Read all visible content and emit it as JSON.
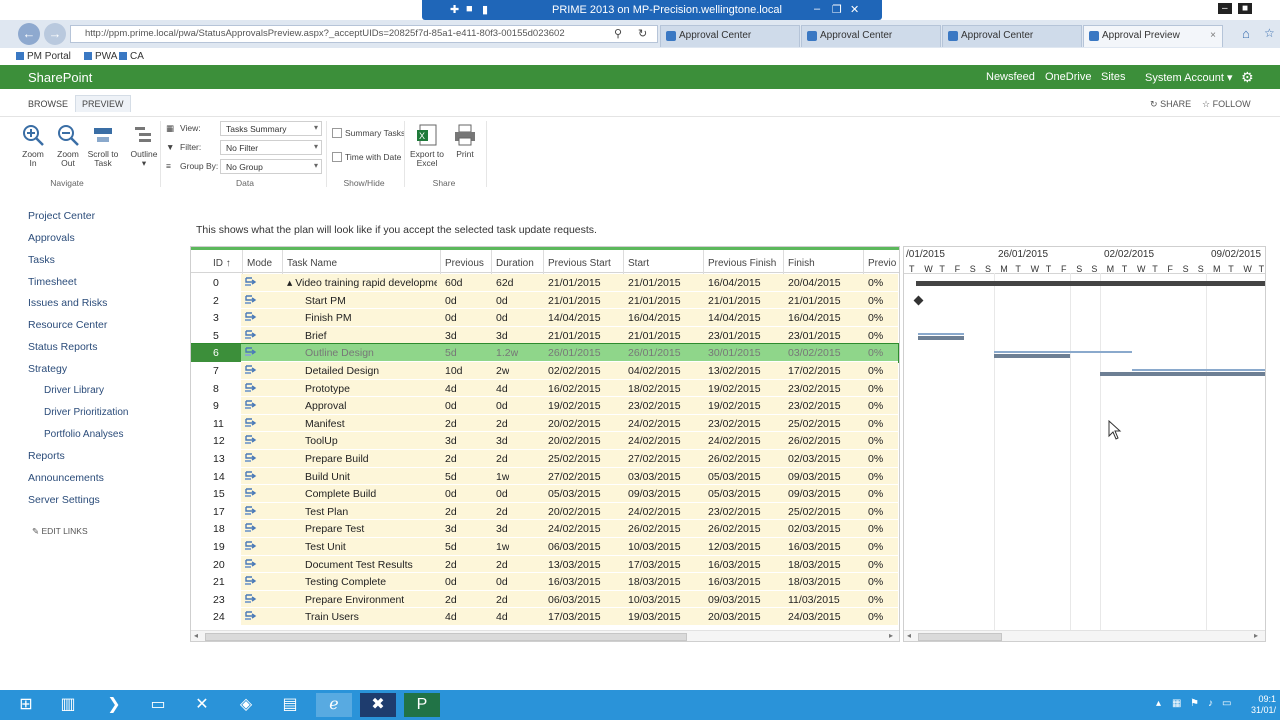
{
  "remote_title": "PRIME 2013 on MP-Precision.wellingtone.local",
  "browser": {
    "address": "http://ppm.prime.local/pwa/StatusApprovalsPreview.aspx?_acceptUIDs=20825f7d-85a1-e411-80f3-00155d023602",
    "tabs": [
      "Approval Center",
      "Approval Center",
      "Approval Center",
      "Approval Preview"
    ],
    "favorites": [
      "PM Portal",
      "PWA",
      "CA"
    ]
  },
  "suite": {
    "brand": "SharePoint",
    "links": [
      "Newsfeed",
      "OneDrive",
      "Sites"
    ],
    "account": "System Account"
  },
  "ribbon_tabs": {
    "browse": "BROWSE",
    "preview": "PREVIEW",
    "share": "SHARE",
    "follow": "FOLLOW"
  },
  "ribbon": {
    "zoom_in": "Zoom In",
    "zoom_out": "Zoom Out",
    "scroll": "Scroll to Task",
    "outline": "Outline",
    "navigate": "Navigate",
    "view_label": "View:",
    "view_value": "Tasks Summary",
    "filter_label": "Filter:",
    "filter_value": "No Filter",
    "group_label": "Group By:",
    "group_value": "No Group",
    "data": "Data",
    "summary_tasks": "Summary Tasks",
    "time_with_date": "Time with Date",
    "showhide": "Show/Hide",
    "export": "Export to Excel",
    "print": "Print",
    "share": "Share"
  },
  "leftnav": [
    {
      "label": "Project Center",
      "sub": false
    },
    {
      "label": "Approvals",
      "sub": false
    },
    {
      "label": "Tasks",
      "sub": false
    },
    {
      "label": "Timesheet",
      "sub": false
    },
    {
      "label": "Issues and Risks",
      "sub": false
    },
    {
      "label": "Resource Center",
      "sub": false
    },
    {
      "label": "Status Reports",
      "sub": false
    },
    {
      "label": "Strategy",
      "sub": false
    },
    {
      "label": "Driver Library",
      "sub": true
    },
    {
      "label": "Driver Prioritization",
      "sub": true
    },
    {
      "label": "Portfolio Analyses",
      "sub": true
    },
    {
      "label": "Reports",
      "sub": false
    },
    {
      "label": "Announcements",
      "sub": false
    },
    {
      "label": "Server Settings",
      "sub": false
    }
  ],
  "edit_links": "EDIT LINKS",
  "message": "This shows what the plan will look like if you accept the selected task update requests.",
  "columns": [
    "ID ↑",
    "Mode",
    "Task Name",
    "Previous",
    "Duration",
    "Previous Start",
    "Start",
    "Previous Finish",
    "Finish",
    "Previo"
  ],
  "rows": [
    {
      "id": "0",
      "name": "▴ Video training rapid developme",
      "prev": "60d",
      "dur": "62d",
      "pstart": "21/01/2015",
      "start": "21/01/2015",
      "pfinish": "16/04/2015",
      "finish": "20/04/2015",
      "pct": "0%",
      "summary": true
    },
    {
      "id": "2",
      "name": "Start PM",
      "prev": "0d",
      "dur": "0d",
      "pstart": "21/01/2015",
      "start": "21/01/2015",
      "pfinish": "21/01/2015",
      "finish": "21/01/2015",
      "pct": "0%"
    },
    {
      "id": "3",
      "name": "Finish PM",
      "prev": "0d",
      "dur": "0d",
      "pstart": "14/04/2015",
      "start": "16/04/2015",
      "pfinish": "14/04/2015",
      "finish": "16/04/2015",
      "pct": "0%"
    },
    {
      "id": "5",
      "name": "Brief",
      "prev": "3d",
      "dur": "3d",
      "pstart": "21/01/2015",
      "start": "21/01/2015",
      "pfinish": "23/01/2015",
      "finish": "23/01/2015",
      "pct": "0%"
    },
    {
      "id": "6",
      "name": "Outline Design",
      "prev": "5d",
      "dur": "1.2w",
      "pstart": "26/01/2015",
      "start": "26/01/2015",
      "pfinish": "30/01/2015",
      "finish": "03/02/2015",
      "pct": "0%",
      "selected": true
    },
    {
      "id": "7",
      "name": "Detailed Design",
      "prev": "10d",
      "dur": "2w",
      "pstart": "02/02/2015",
      "start": "04/02/2015",
      "pfinish": "13/02/2015",
      "finish": "17/02/2015",
      "pct": "0%"
    },
    {
      "id": "8",
      "name": "Prototype",
      "prev": "4d",
      "dur": "4d",
      "pstart": "16/02/2015",
      "start": "18/02/2015",
      "pfinish": "19/02/2015",
      "finish": "23/02/2015",
      "pct": "0%"
    },
    {
      "id": "9",
      "name": "Approval",
      "prev": "0d",
      "dur": "0d",
      "pstart": "19/02/2015",
      "start": "23/02/2015",
      "pfinish": "19/02/2015",
      "finish": "23/02/2015",
      "pct": "0%"
    },
    {
      "id": "11",
      "name": "Manifest",
      "prev": "2d",
      "dur": "2d",
      "pstart": "20/02/2015",
      "start": "24/02/2015",
      "pfinish": "23/02/2015",
      "finish": "25/02/2015",
      "pct": "0%"
    },
    {
      "id": "12",
      "name": "ToolUp",
      "prev": "3d",
      "dur": "3d",
      "pstart": "20/02/2015",
      "start": "24/02/2015",
      "pfinish": "24/02/2015",
      "finish": "26/02/2015",
      "pct": "0%"
    },
    {
      "id": "13",
      "name": "Prepare Build",
      "prev": "2d",
      "dur": "2d",
      "pstart": "25/02/2015",
      "start": "27/02/2015",
      "pfinish": "26/02/2015",
      "finish": "02/03/2015",
      "pct": "0%"
    },
    {
      "id": "14",
      "name": "Build Unit",
      "prev": "5d",
      "dur": "1w",
      "pstart": "27/02/2015",
      "start": "03/03/2015",
      "pfinish": "05/03/2015",
      "finish": "09/03/2015",
      "pct": "0%"
    },
    {
      "id": "15",
      "name": "Complete Build",
      "prev": "0d",
      "dur": "0d",
      "pstart": "05/03/2015",
      "start": "09/03/2015",
      "pfinish": "05/03/2015",
      "finish": "09/03/2015",
      "pct": "0%"
    },
    {
      "id": "17",
      "name": "Test Plan",
      "prev": "2d",
      "dur": "2d",
      "pstart": "20/02/2015",
      "start": "24/02/2015",
      "pfinish": "23/02/2015",
      "finish": "25/02/2015",
      "pct": "0%"
    },
    {
      "id": "18",
      "name": "Prepare Test",
      "prev": "3d",
      "dur": "3d",
      "pstart": "24/02/2015",
      "start": "26/02/2015",
      "pfinish": "26/02/2015",
      "finish": "02/03/2015",
      "pct": "0%"
    },
    {
      "id": "19",
      "name": "Test Unit",
      "prev": "5d",
      "dur": "1w",
      "pstart": "06/03/2015",
      "start": "10/03/2015",
      "pfinish": "12/03/2015",
      "finish": "16/03/2015",
      "pct": "0%"
    },
    {
      "id": "20",
      "name": "Document Test Results",
      "prev": "2d",
      "dur": "2d",
      "pstart": "13/03/2015",
      "start": "17/03/2015",
      "pfinish": "16/03/2015",
      "finish": "18/03/2015",
      "pct": "0%"
    },
    {
      "id": "21",
      "name": "Testing Complete",
      "prev": "0d",
      "dur": "0d",
      "pstart": "16/03/2015",
      "start": "18/03/2015",
      "pfinish": "16/03/2015",
      "finish": "18/03/2015",
      "pct": "0%"
    },
    {
      "id": "23",
      "name": "Prepare Environment",
      "prev": "2d",
      "dur": "2d",
      "pstart": "06/03/2015",
      "start": "10/03/2015",
      "pfinish": "09/03/2015",
      "finish": "11/03/2015",
      "pct": "0%"
    },
    {
      "id": "24",
      "name": "Train Users",
      "prev": "4d",
      "dur": "4d",
      "pstart": "17/03/2015",
      "start": "19/03/2015",
      "pfinish": "20/03/2015",
      "finish": "24/03/2015",
      "pct": "0%"
    }
  ],
  "gantt": {
    "weeks": [
      "/01/2015",
      "26/01/2015",
      "02/02/2015",
      "09/02/2015"
    ],
    "days": [
      "T",
      "W",
      "T",
      "F",
      "S",
      "S",
      "M",
      "T",
      "W",
      "T",
      "F",
      "S",
      "S",
      "M",
      "T",
      "W",
      "T",
      "F",
      "S",
      "S",
      "M",
      "T",
      "W",
      "T"
    ]
  },
  "clock": {
    "time": "09:1",
    "date": "31/01/"
  },
  "colors": {
    "suite": "#3c8f3a",
    "selected_row": "#8fd68a",
    "row_bg": "#fdf6d9",
    "taskbar": "#2a93d9"
  }
}
